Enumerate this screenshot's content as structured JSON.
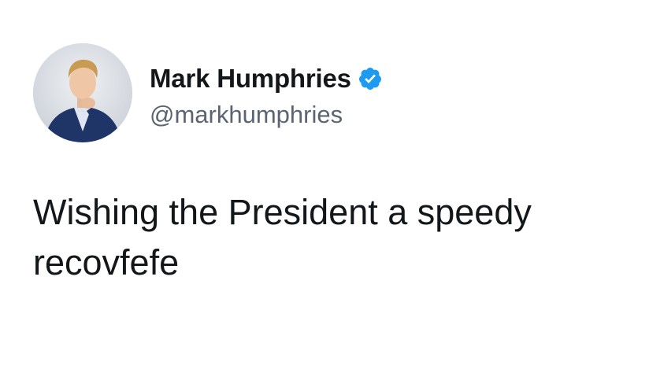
{
  "tweet": {
    "author": {
      "display_name": "Mark Humphries",
      "handle": "@markhumphries",
      "verified": true,
      "avatar_icon": "profile-photo"
    },
    "text_line1": "Wishing the President a speedy",
    "text_line2": "recovfefe"
  },
  "colors": {
    "verified_badge": "#1d9bf0",
    "text": "#14171a",
    "handle": "#5b6470",
    "background": "#ffffff"
  }
}
